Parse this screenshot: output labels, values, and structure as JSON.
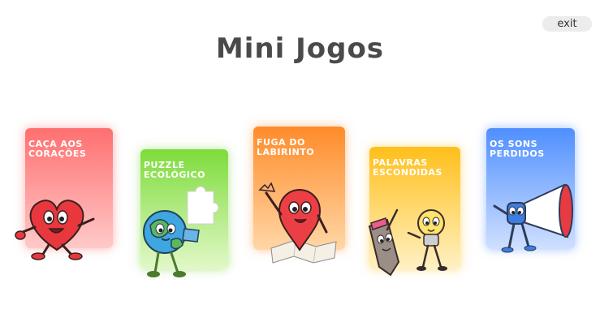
{
  "header": {
    "title": "Mini Jogos",
    "exit_label": "exit"
  },
  "games": [
    {
      "title": "CAÇA AOS\nCORAÇÕES",
      "color": "#ff6f6f",
      "mascot": "heart-character-icon"
    },
    {
      "title": "PUZZLE\nECOLÓGICO",
      "color": "#7ddc3b",
      "mascot": "earth-puzzle-character-icon"
    },
    {
      "title": "FUGA DO\nLABIRINTO",
      "color": "#ff8b2a",
      "mascot": "map-pin-character-icon"
    },
    {
      "title": "PALAVRAS\nESCONDIDAS",
      "color": "#ffbf1a",
      "mascot": "pencil-and-lightbulb-characters-icon"
    },
    {
      "title": "OS SONS\nPERDIDOS",
      "color": "#4f8fff",
      "mascot": "megaphone-character-icon"
    }
  ]
}
